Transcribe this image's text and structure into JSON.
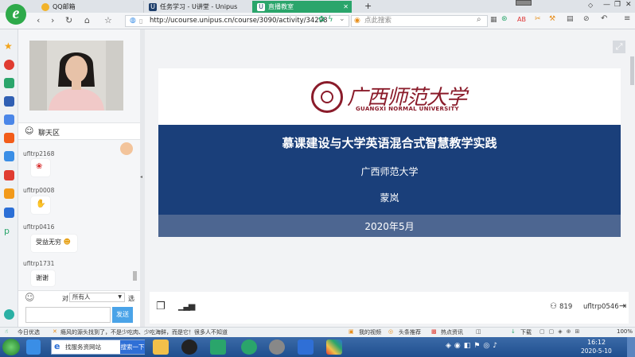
{
  "browser": {
    "tabs": [
      {
        "label": "QQ邮箱",
        "active": false
      },
      {
        "label": "任务学习 - U讲堂 - Unipus",
        "active": false
      },
      {
        "label": "直播教室",
        "active": true
      }
    ],
    "new_tab": "+",
    "url": "http://ucourse.unipus.cn/course/3090/activity/34298",
    "search_placeholder": "点此搜索"
  },
  "chat": {
    "title": "聊天区",
    "messages": [
      {
        "user": "ufltrp2168",
        "text": "",
        "emoji": "rose"
      },
      {
        "user": "ufltrp0008",
        "text": "",
        "emoji": "clap"
      },
      {
        "user": "ufltrp0416",
        "text": "受益无穷",
        "emoji": "heart-eyes"
      },
      {
        "user": "ufltrp1731",
        "text": "谢谢",
        "emoji": ""
      }
    ],
    "to_label": "对",
    "recipient": "所有人",
    "select_label": "选",
    "send_label": "发送"
  },
  "slide": {
    "university_cn": "广西师范大学",
    "university_en": "GUANGXI NORMAL UNIVERSITY",
    "title": "慕课建设与大学英语混合式智慧教学实践",
    "subtitle": "广西师范大学",
    "speaker": "蒙岚",
    "date": "2020年5月"
  },
  "controls": {
    "viewers": "819",
    "username": "ufltrp0546"
  },
  "statusbar": {
    "left": "今日优选",
    "news": "瘾风的源头找到了，不是少吃肉、少吃海鲜，而是它！很多人不知道",
    "items": [
      "我的视频",
      "头条推荐",
      "热点资讯",
      "下载"
    ],
    "zoom": "100%"
  },
  "taskbar": {
    "ie_label": "找服务资网站",
    "search_label": "搜索一下",
    "time": "16:12",
    "date": "2020-5-10"
  },
  "colors": {
    "banner": "#1a3f7a",
    "datebar": "#4d6691",
    "active_tab": "#2aa56b",
    "send": "#4aa3e8"
  }
}
